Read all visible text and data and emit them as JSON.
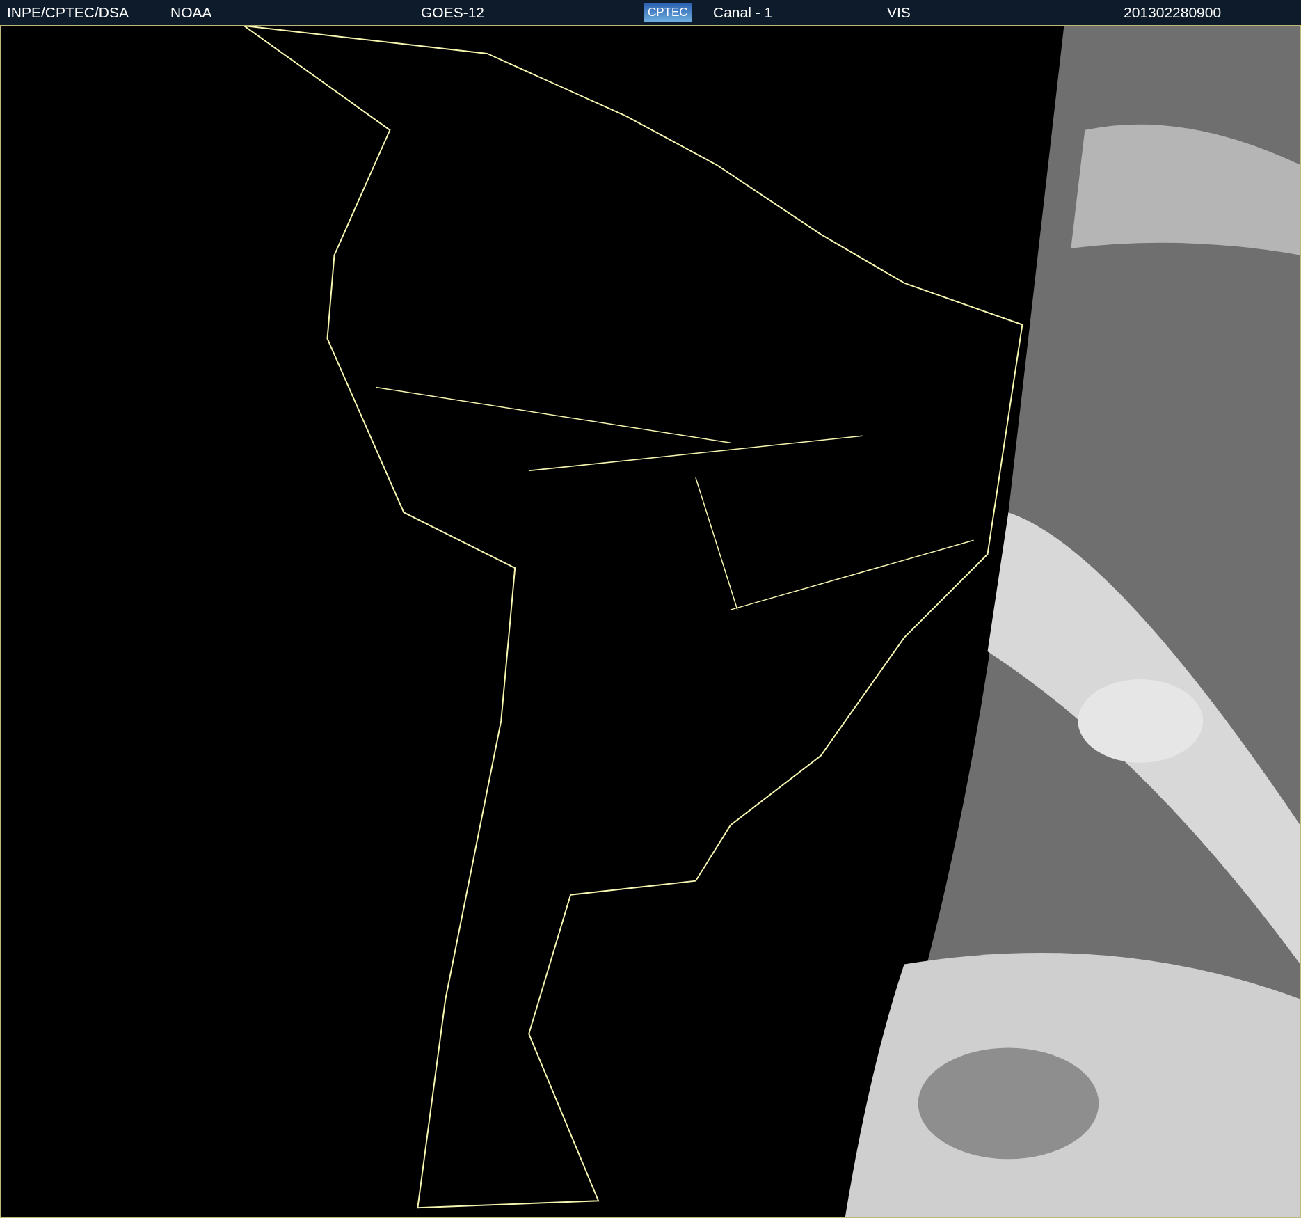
{
  "header": {
    "source": "INPE/CPTEC/DSA",
    "agency": "NOAA",
    "satellite": "GOES-12",
    "logo_text": "CPTEC",
    "channel": "Canal - 1",
    "band": "VIS",
    "timestamp": "201302280900"
  }
}
